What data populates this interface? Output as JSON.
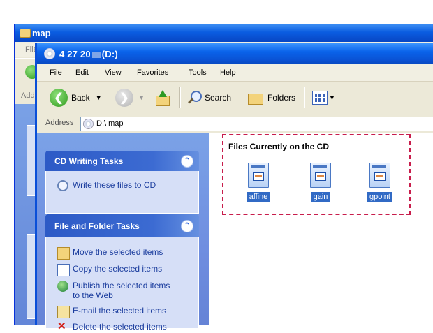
{
  "back_window": {
    "title": "map",
    "menu_partial": "File",
    "address_partial": "Add"
  },
  "window": {
    "title_prefix": "4 27 20",
    "title_suffix": "(D:)"
  },
  "menu": [
    "File",
    "Edit",
    "View",
    "Favorites",
    "Tools",
    "Help"
  ],
  "toolbar": {
    "back_label": "Back",
    "search_label": "Search",
    "folders_label": "Folders"
  },
  "address": {
    "label": "Address",
    "value": "D:\\ map"
  },
  "tasks": {
    "cd_writing": {
      "title": "CD Writing Tasks",
      "items": [
        "Write these files to CD"
      ]
    },
    "file_folder": {
      "title": "File and Folder Tasks",
      "items": [
        "Move the selected items",
        "Copy the selected items",
        "Publish the selected items",
        "to the Web",
        "E-mail the selected items",
        "Delete the selected items"
      ]
    }
  },
  "content": {
    "header": "Files Currently on the CD",
    "files": [
      "affine",
      "gain",
      "gpoint"
    ]
  },
  "colors": {
    "titlebar": "#0a52d4",
    "task_pane": "#7ba2e7",
    "highlight_dash": "#c81d4c",
    "selection": "#316ac5"
  }
}
